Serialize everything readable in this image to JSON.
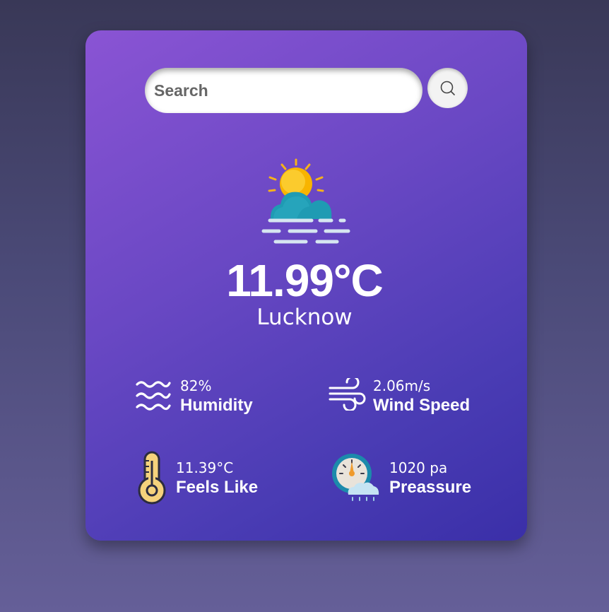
{
  "search": {
    "placeholder": "Search",
    "value": ""
  },
  "weather": {
    "temperature": "11.99°C",
    "city": "Lucknow",
    "condition_icon": "sun-cloud-fog-icon"
  },
  "stats": {
    "humidity": {
      "value": "82%",
      "label": "Humidity",
      "icon": "humidity-waves-icon"
    },
    "wind": {
      "value": "2.06m/s",
      "label": "Wind Speed",
      "icon": "wind-icon"
    },
    "feels_like": {
      "value": "11.39°C",
      "label": "Feels Like",
      "icon": "thermometer-icon"
    },
    "pressure": {
      "value": "1020 pa",
      "label": "Preassure",
      "icon": "pressure-gauge-icon"
    }
  },
  "colors": {
    "card_top": "#8a54d4",
    "card_bottom": "#3a2fa8",
    "background": "#4b4a78",
    "text": "#ffffff"
  }
}
